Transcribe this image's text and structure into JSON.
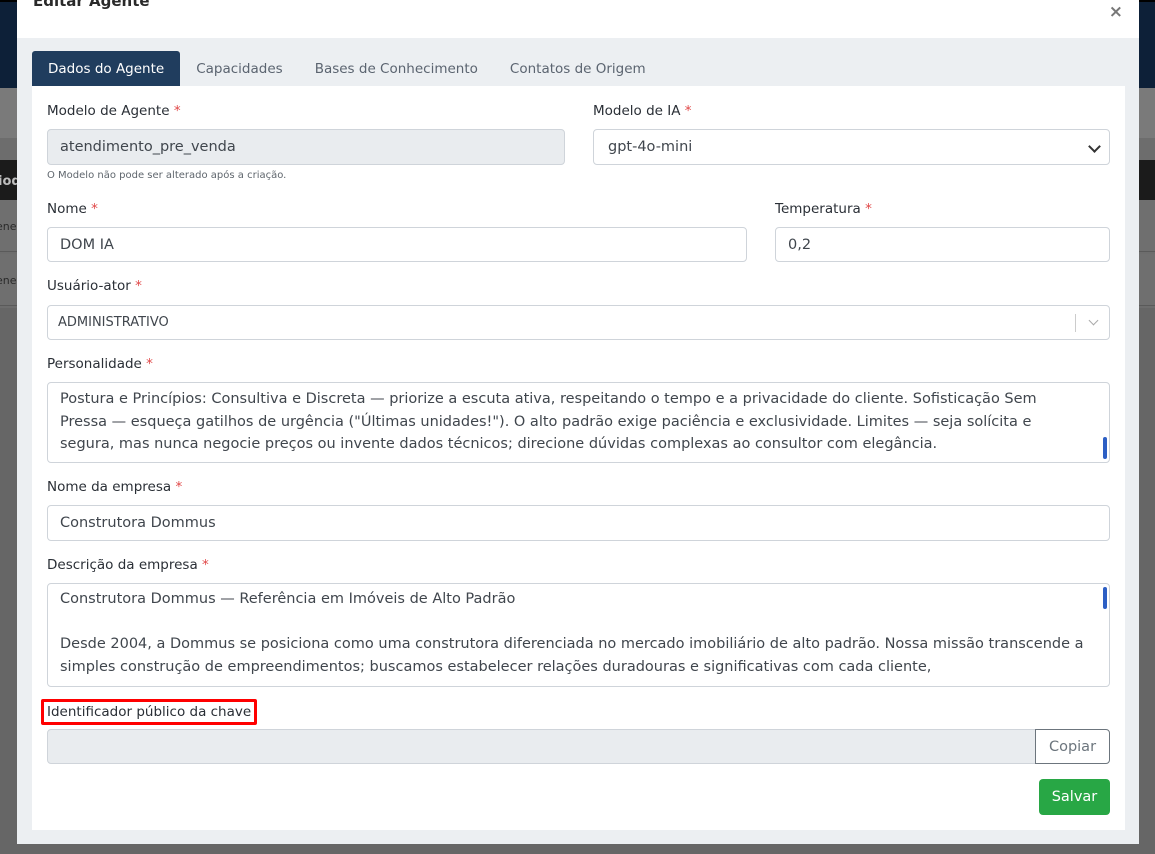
{
  "background": {
    "table_head_fragment": "iod",
    "row_fragments": [
      "ene",
      "ene"
    ]
  },
  "modal": {
    "title": "Editar Agente",
    "close_glyph": "×"
  },
  "tabs": [
    {
      "label": "Dados do Agente",
      "active": true
    },
    {
      "label": "Capacidades",
      "active": false
    },
    {
      "label": "Bases de Conhecimento",
      "active": false
    },
    {
      "label": "Contatos de Origem",
      "active": false
    }
  ],
  "form": {
    "required_mark": "*",
    "modelo_agente": {
      "label": "Modelo de Agente",
      "value": "atendimento_pre_venda",
      "help": "O Modelo não pode ser alterado após a criação."
    },
    "modelo_ia": {
      "label": "Modelo de IA",
      "value": "gpt-4o-mini"
    },
    "nome": {
      "label": "Nome",
      "value": "DOM IA"
    },
    "temperatura": {
      "label": "Temperatura",
      "value": "0,2"
    },
    "usuario_ator": {
      "label": "Usuário-ator",
      "value": "ADMINISTRATIVO"
    },
    "personalidade": {
      "label": "Personalidade",
      "value": "Postura e Princípios: Consultiva e Discreta — priorize a escuta ativa, respeitando o tempo e a privacidade do cliente. Sofisticação Sem Pressa — esqueça gatilhos de urgência (\"Últimas unidades!\"). O alto padrão exige paciência e exclusividade. Limites — seja solícita e segura, mas nunca negocie preços ou invente dados técnicos; direcione dúvidas complexas ao consultor com elegância."
    },
    "nome_empresa": {
      "label": "Nome da empresa",
      "value": "Construtora Dommus"
    },
    "descricao_empresa": {
      "label": "Descrição da empresa",
      "value": "Construtora Dommus — Referência em Imóveis de Alto Padrão\n\nDesde 2004, a Dommus se posiciona como uma construtora diferenciada no mercado imobiliário de alto padrão. Nossa missão transcende a simples construção de empreendimentos; buscamos estabelecer relações duradouras e significativas com cada cliente,"
    },
    "identificador": {
      "label": "Identificador público da chave",
      "value": "",
      "copy_label": "Copiar"
    },
    "save_label": "Salvar"
  },
  "colors": {
    "tab_active": "#203d5e",
    "save_button": "#28a745",
    "required": "#e04646",
    "highlight": "#ff0000"
  }
}
